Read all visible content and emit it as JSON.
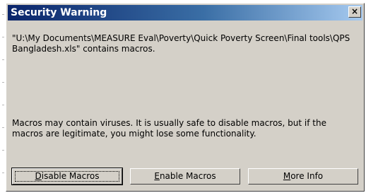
{
  "dialog": {
    "title": "Security Warning",
    "close_label": "×",
    "message_path": "\"U:\\My Documents\\MEASURE Eval\\Poverty\\Quick Poverty Screen\\Final tools\\QPS Bangladesh.xls\" contains macros.",
    "message_warning": "Macros may contain viruses. It is usually safe to disable macros, but if the macros are legitimate, you might lose some functionality."
  },
  "buttons": {
    "disable": {
      "mnemonic": "D",
      "rest": "isable Macros"
    },
    "enable": {
      "mnemonic": "E",
      "rest": "nable Macros"
    },
    "more_info": {
      "mnemonic": "M",
      "rest": "ore Info"
    }
  }
}
